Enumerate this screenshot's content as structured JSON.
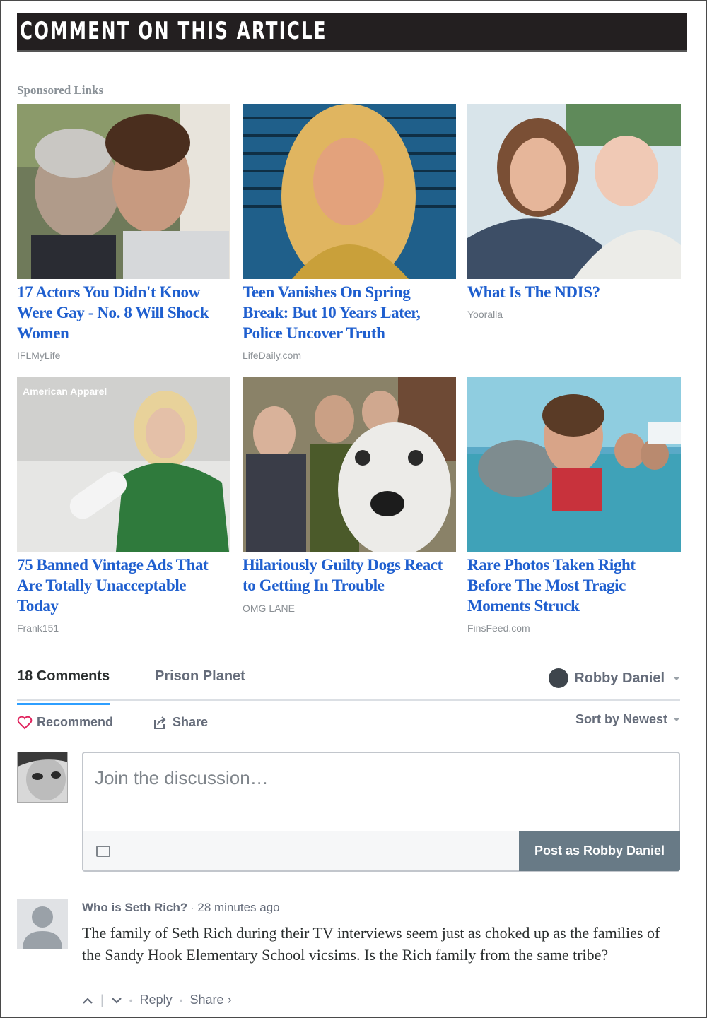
{
  "header": {
    "title": "COMMENT ON THIS ARTICLE"
  },
  "sponsored": {
    "label": "Sponsored Links",
    "ads": [
      {
        "title": "17 Actors You Didn't Know Were Gay - No. 8 Will Shock Women",
        "source": "IFLMyLife"
      },
      {
        "title": "Teen Vanishes On Spring Break: But 10 Years Later, Police Uncover Truth",
        "source": "LifeDaily.com"
      },
      {
        "title": "What Is The NDIS?",
        "source": "Yooralla"
      },
      {
        "title": "75 Banned Vintage Ads That Are Totally Unacceptable Today",
        "source": "Frank151",
        "overlay": "American Apparel"
      },
      {
        "title": "Hilariously Guilty Dogs React to Getting In Trouble",
        "source": "OMG LANE"
      },
      {
        "title": "Rare Photos Taken Right Before The Most Tragic Moments Struck",
        "source": "FinsFeed.com"
      }
    ]
  },
  "discussion": {
    "tab_comments": "18 Comments",
    "tab_site": "Prison Planet",
    "user_name": "Robby Daniel",
    "recommend_label": "Recommend",
    "share_label": "Share",
    "sort_label": "Sort by Newest",
    "composer_placeholder": "Join the discussion…",
    "post_button": "Post as Robby Daniel"
  },
  "comments": [
    {
      "author": "Who is  Seth Rich?",
      "time": "28 minutes ago",
      "body": "The family of Seth Rich during their TV interviews seem just as choked up as the families of the Sandy Hook Elementary School vicsims. Is the Rich family from the same tribe?",
      "reply_label": "Reply",
      "share_label": "Share ›"
    }
  ],
  "icons": {
    "heart": "heart-icon",
    "share": "share-icon",
    "user": "user-icon",
    "image": "image-icon",
    "upvote": "chevron-up-icon",
    "downvote": "chevron-down-icon"
  },
  "colors": {
    "header_bg": "#231f20",
    "ad_title": "#1f5fcf",
    "active_tab": "#2e9fff",
    "post_button": "#687a86",
    "heart": "#e0245e"
  }
}
